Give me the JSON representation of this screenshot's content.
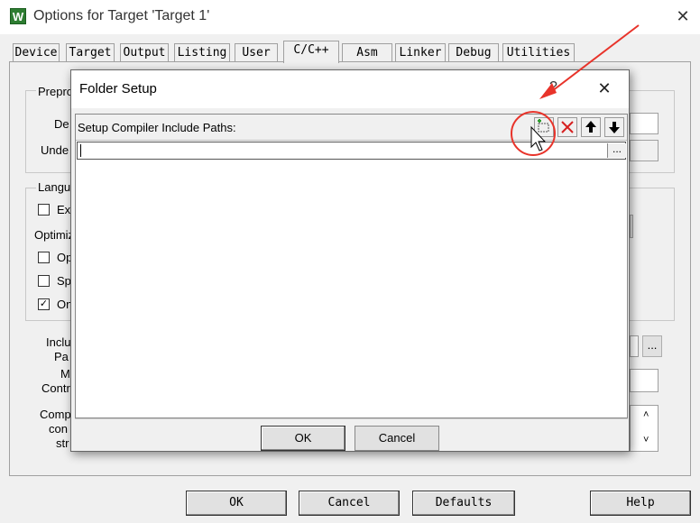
{
  "main": {
    "title": "Options for Target 'Target 1'",
    "app_icon_letter": "W",
    "close_glyph": "✕",
    "tabs": [
      {
        "label": "Device"
      },
      {
        "label": "Target"
      },
      {
        "label": "Output"
      },
      {
        "label": "Listing"
      },
      {
        "label": "User"
      },
      {
        "label": "C/C++"
      },
      {
        "label": "Asm"
      },
      {
        "label": "Linker"
      },
      {
        "label": "Debug"
      },
      {
        "label": "Utilities"
      }
    ],
    "active_tab": "C/C++",
    "background_labels": {
      "preprocessor": "Prepro",
      "define": "De",
      "undefine": "Unde",
      "language": "Langu",
      "ex": "Ex",
      "optimization": "Optimiz",
      "op": "Op",
      "sp": "Sp",
      "on": "On",
      "include": "Inclu",
      "paths": "Pa",
      "misc": "M",
      "controls": "Contr",
      "compiler": "Comp",
      "control": "con",
      "string": "str"
    },
    "buttons": {
      "ok": "OK",
      "cancel": "Cancel",
      "defaults": "Defaults",
      "help": "Help"
    }
  },
  "dialog": {
    "title": "Folder Setup",
    "help_glyph": "?",
    "close_glyph": "✕",
    "list_header": "Setup Compiler Include Paths:",
    "toolbar": {
      "new_icon": "new-folder-icon",
      "delete_icon": "delete-icon",
      "up_icon": "move-up-icon",
      "down_icon": "move-down-icon"
    },
    "browse_label": "...",
    "ok_label": "OK",
    "cancel_label": "Cancel"
  },
  "colors": {
    "annotation_red": "#e8332a",
    "window_bg": "#f0f0f0"
  }
}
